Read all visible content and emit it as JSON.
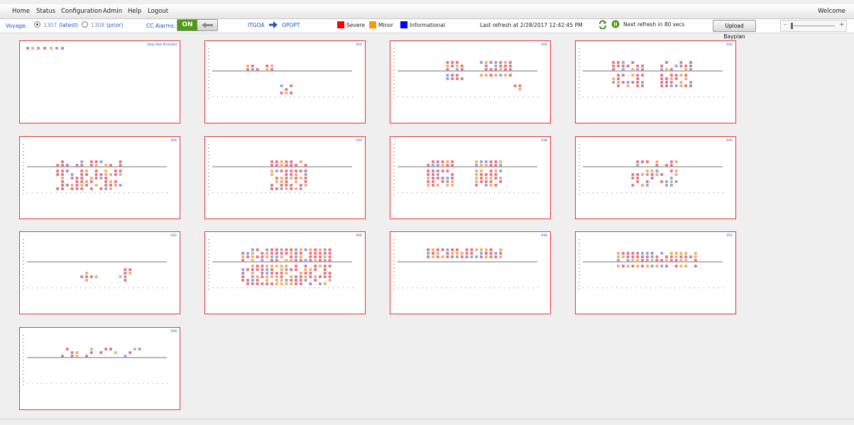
{
  "menu": {
    "items": [
      "Home",
      "Status",
      "Configuration",
      "Admin",
      "Help",
      "Logout"
    ],
    "welcome": "Welcome"
  },
  "toolbar": {
    "voyage_label": "Voyage:",
    "voyage_latest_num": "1307",
    "voyage_latest_tag": "(latest)",
    "voyage_prior_num": "1308",
    "voyage_prior_tag": "(prior)",
    "cc_alarms_label": "CC Alarms:",
    "cc_alarms_state": "ON",
    "port_from": "ITGOA",
    "port_to": "OPOPT",
    "legend": [
      {
        "label": "Severe",
        "color": "#ff0000"
      },
      {
        "label": "Minor",
        "color": "#ff9900"
      },
      {
        "label": "Informational",
        "color": "#0000ff"
      }
    ],
    "last_refresh": "Last refresh at 2/28/2017 12:42:45 PM",
    "next_refresh": "Next refresh in 80 secs",
    "upload_button": "Upload Bayplan"
  },
  "colors": {
    "severe_cell": "#e07a8a",
    "minor_cell": "#f0b070",
    "info_cell": "#8fa8e0",
    "card_border": "#ee3333",
    "accent_blue": "#1a56c8",
    "on_green": "#4f9a16"
  },
  "bays": [
    {
      "label": "Bays Not Provided"
    },
    {
      "label": "010"
    },
    {
      "label": "018"
    },
    {
      "label": "026"
    },
    {
      "label": "026"
    },
    {
      "label": "030"
    },
    {
      "label": "038"
    },
    {
      "label": "042"
    },
    {
      "label": "042"
    },
    {
      "label": "046"
    },
    {
      "label": "048"
    },
    {
      "label": "052"
    },
    {
      "label": "058"
    }
  ]
}
